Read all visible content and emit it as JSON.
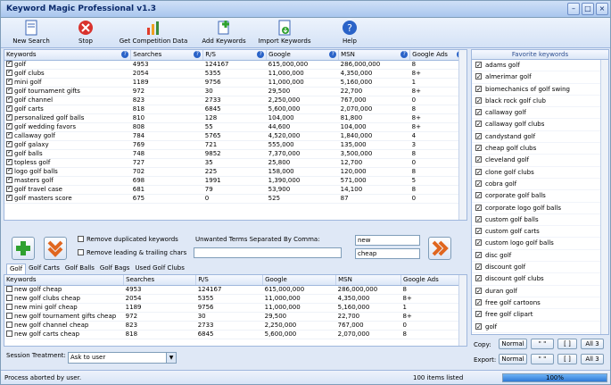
{
  "window": {
    "title": "Keyword Magic Professional v1.3"
  },
  "toolbar": [
    {
      "label": "New Search",
      "icon": "new-search-icon"
    },
    {
      "label": "Stop",
      "icon": "stop-icon"
    },
    {
      "label": "Get Competition Data",
      "icon": "competition-chart-icon"
    },
    {
      "label": "Add Keywords",
      "icon": "add-keywords-icon"
    },
    {
      "label": "Import Keywords",
      "icon": "import-keywords-icon"
    },
    {
      "label": "Help",
      "icon": "help-icon"
    }
  ],
  "main_table": {
    "headers": [
      "Keywords",
      "Searches",
      "R/S",
      "Google",
      "MSN",
      "Google Ads"
    ],
    "rows": [
      [
        "golf",
        "4953",
        "124167",
        "615,000,000",
        "286,000,000",
        "8"
      ],
      [
        "golf clubs",
        "2054",
        "5355",
        "11,000,000",
        "4,350,000",
        "8+"
      ],
      [
        "mini golf",
        "1189",
        "9756",
        "11,000,000",
        "5,160,000",
        "1"
      ],
      [
        "golf tournament gifts",
        "972",
        "30",
        "29,500",
        "22,700",
        "8+"
      ],
      [
        "golf channel",
        "823",
        "2733",
        "2,250,000",
        "767,000",
        "0"
      ],
      [
        "golf carts",
        "818",
        "6845",
        "5,600,000",
        "2,070,000",
        "8"
      ],
      [
        "personalized golf balls",
        "810",
        "128",
        "104,000",
        "81,800",
        "8+"
      ],
      [
        "golf wedding favors",
        "808",
        "55",
        "44,600",
        "104,000",
        "8+"
      ],
      [
        "callaway golf",
        "784",
        "5765",
        "4,520,000",
        "1,840,000",
        "4"
      ],
      [
        "golf galaxy",
        "769",
        "721",
        "555,000",
        "135,000",
        "3"
      ],
      [
        "golf balls",
        "748",
        "9852",
        "7,370,000",
        "3,500,000",
        "8"
      ],
      [
        "topless golf",
        "727",
        "35",
        "25,800",
        "12,700",
        "0"
      ],
      [
        "logo golf balls",
        "702",
        "225",
        "158,000",
        "120,000",
        "8"
      ],
      [
        "masters golf",
        "698",
        "1991",
        "1,390,000",
        "571,000",
        "5"
      ],
      [
        "golf travel case",
        "681",
        "79",
        "53,900",
        "14,100",
        "8"
      ],
      [
        "golf masters score",
        "675",
        "0",
        "525",
        "87",
        "0"
      ]
    ]
  },
  "mid": {
    "remove_duplicated": "Remove duplicated keywords",
    "remove_leading": "Remove leading & trailing chars",
    "unwanted_label": "Unwanted Terms Separated By Comma:",
    "terms": [
      "new",
      "cheap"
    ]
  },
  "tabs": [
    "Golf",
    "Golf Carts",
    "Golf Balls",
    "Golf Bags",
    "Used Golf Clubs"
  ],
  "lower_table": {
    "headers": [
      "Keywords",
      "Searches",
      "R/S",
      "Google",
      "MSN",
      "Google Ads"
    ],
    "rows": [
      [
        "new golf cheap",
        "4953",
        "124167",
        "615,000,000",
        "286,000,000",
        "8"
      ],
      [
        "new golf clubs cheap",
        "2054",
        "5355",
        "11,000,000",
        "4,350,000",
        "8+"
      ],
      [
        "new mini golf cheap",
        "1189",
        "9756",
        "11,000,000",
        "5,160,000",
        "1"
      ],
      [
        "new golf tournament gifts cheap",
        "972",
        "30",
        "29,500",
        "22,700",
        "8+"
      ],
      [
        "new golf channel cheap",
        "823",
        "2733",
        "2,250,000",
        "767,000",
        "0"
      ],
      [
        "new golf carts cheap",
        "818",
        "6845",
        "5,600,000",
        "2,070,000",
        "8"
      ]
    ]
  },
  "session": {
    "label": "Session Treatment:",
    "value": "Ask to user"
  },
  "favorites": {
    "title": "Favorite keywords",
    "items": [
      "adams golf",
      "almerimar golf",
      "biomechanics of golf swing",
      "black rock golf club",
      "callaway golf",
      "callaway golf clubs",
      "candystand golf",
      "cheap golf clubs",
      "cleveland golf",
      "clone golf clubs",
      "cobra golf",
      "corporate golf balls",
      "corporate logo golf balls",
      "custom golf balls",
      "custom golf carts",
      "custom logo golf balls",
      "disc golf",
      "discount golf",
      "discount golf clubs",
      "duran golf",
      "free golf cartoons",
      "free golf clipart",
      "golf"
    ]
  },
  "copy": {
    "label": "Copy:",
    "buttons": [
      "Normal",
      "\" \"",
      "[ ]",
      "All 3"
    ]
  },
  "export": {
    "label": "Export:",
    "buttons": [
      "Normal",
      "\" \"",
      "[ ]",
      "All 3"
    ]
  },
  "status": {
    "message": "Process aborted by user.",
    "count": "100 items listed",
    "progress_label": "100%",
    "progress": 1.0
  }
}
